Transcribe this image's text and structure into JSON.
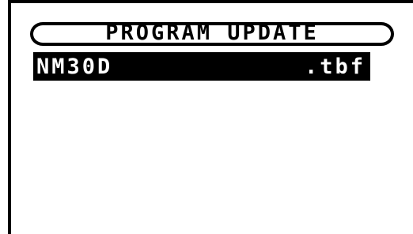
{
  "screen": {
    "title": "PROGRAM UPDATE",
    "files": [
      {
        "name": "NM30D",
        "extension": ".tbf"
      }
    ]
  },
  "colors": {
    "foreground": "#000000",
    "background": "#ffffff",
    "highlight_text": "#ffffff"
  }
}
